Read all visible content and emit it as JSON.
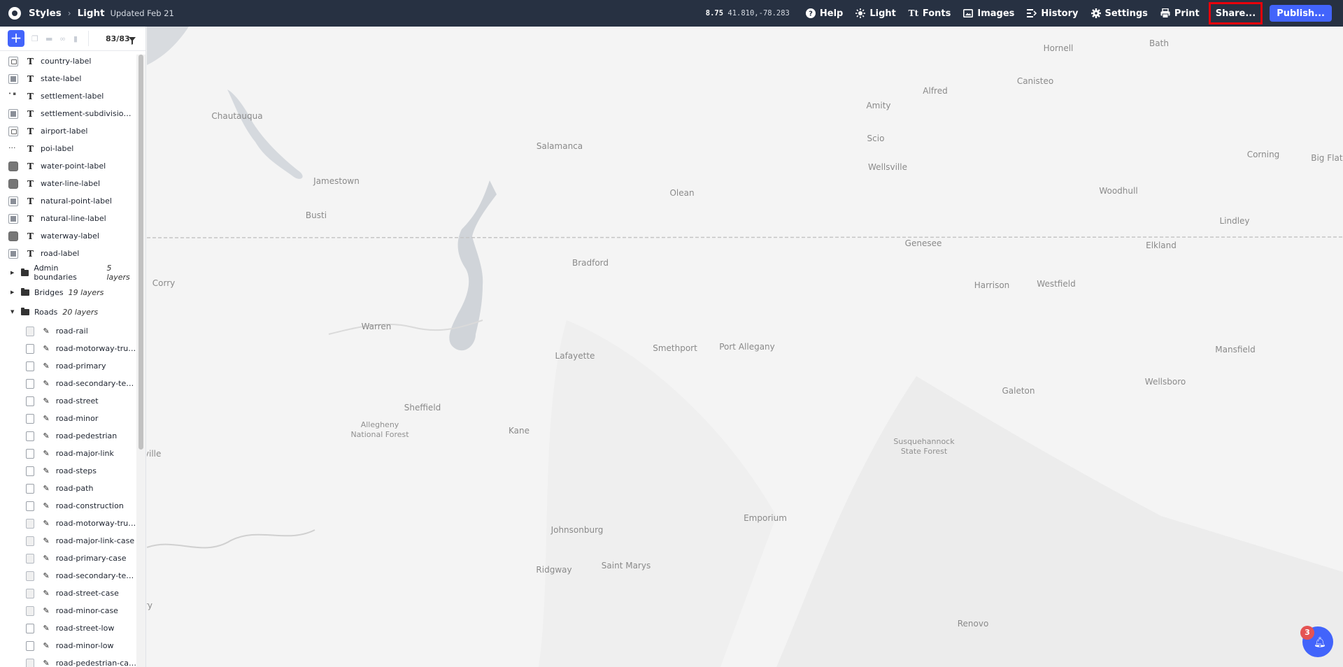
{
  "header": {
    "styles_label": "Styles",
    "style_name": "Light",
    "updated": "Updated Feb 21",
    "zoom": "8.75",
    "coords": "41.810,-78.283",
    "buttons": {
      "help": "Help",
      "light": "Light",
      "fonts": "Fonts",
      "images": "Images",
      "history": "History",
      "settings": "Settings",
      "print": "Print",
      "share": "Share...",
      "publish": "Publish..."
    }
  },
  "sidebar": {
    "layer_count": "83/83",
    "layers": [
      {
        "name": "country-label",
        "swatch": "icon"
      },
      {
        "name": "state-label",
        "swatch": "gray"
      },
      {
        "name": "settlement-label",
        "swatch": "dots"
      },
      {
        "name": "settlement-subdivision-la...",
        "swatch": "gray"
      },
      {
        "name": "airport-label",
        "swatch": "icon"
      },
      {
        "name": "poi-label",
        "swatch": "ell"
      },
      {
        "name": "water-point-label",
        "swatch": "full"
      },
      {
        "name": "water-line-label",
        "swatch": "full"
      },
      {
        "name": "natural-point-label",
        "swatch": "gray"
      },
      {
        "name": "natural-line-label",
        "swatch": "gray"
      },
      {
        "name": "waterway-label",
        "swatch": "full"
      },
      {
        "name": "road-label",
        "swatch": "gray"
      }
    ],
    "groups": [
      {
        "name": "Admin boundaries",
        "count": "5 layers"
      },
      {
        "name": "Bridges",
        "count": "19 layers"
      },
      {
        "name": "Roads",
        "count": "20 layers"
      }
    ],
    "road_layers": [
      {
        "name": "road-rail",
        "swatch": "lgray"
      },
      {
        "name": "road-motorway-trunk",
        "swatch": "blank"
      },
      {
        "name": "road-primary",
        "swatch": "blank"
      },
      {
        "name": "road-secondary-terti...",
        "swatch": "blank"
      },
      {
        "name": "road-street",
        "swatch": "blank"
      },
      {
        "name": "road-minor",
        "swatch": "blank"
      },
      {
        "name": "road-pedestrian",
        "swatch": "blank"
      },
      {
        "name": "road-major-link",
        "swatch": "blank"
      },
      {
        "name": "road-steps",
        "swatch": "blank"
      },
      {
        "name": "road-path",
        "swatch": "blank"
      },
      {
        "name": "road-construction",
        "swatch": "blank"
      },
      {
        "name": "road-motorway-trun...",
        "swatch": "lgray"
      },
      {
        "name": "road-major-link-case",
        "swatch": "lgray"
      },
      {
        "name": "road-primary-case",
        "swatch": "lgray"
      },
      {
        "name": "road-secondary-tertiar...",
        "swatch": "lgray"
      },
      {
        "name": "road-street-case",
        "swatch": "lgray"
      },
      {
        "name": "road-minor-case",
        "swatch": "lgray"
      },
      {
        "name": "road-street-low",
        "swatch": "blank"
      },
      {
        "name": "road-minor-low",
        "swatch": "blank"
      },
      {
        "name": "road-pedestrian-case",
        "swatch": "lgray"
      }
    ]
  },
  "map": {
    "labels": [
      "Bath",
      "Hornell",
      "Alfred",
      "Canisteo",
      "Chautauqua",
      "Amity",
      "Salamanca",
      "Scio",
      "Corning",
      "Big Flats",
      "Jamestown",
      "Wellsville",
      "Olean",
      "Woodhull",
      "Busti",
      "Lindley",
      "Genesee",
      "Elkland",
      "Bradford",
      "Harrison",
      "Westfield",
      "Corry",
      "Warren",
      "Smethport",
      "Port Allegany",
      "Mansfield",
      "Lafayette",
      "Wellsboro",
      "Galeton",
      "Sheffield",
      "Allegheny National Forest",
      "Kane",
      "Susquehannock State Forest",
      "sville",
      "Emporium",
      "Johnsonburg",
      "Ridgway",
      "Saint Marys",
      "Renovo",
      "ry"
    ]
  },
  "notifications": {
    "count": "3"
  },
  "colors": {
    "topbar": "#273142",
    "accent": "#4264fb",
    "highlight": "#e8000b",
    "badge": "#e55353"
  }
}
